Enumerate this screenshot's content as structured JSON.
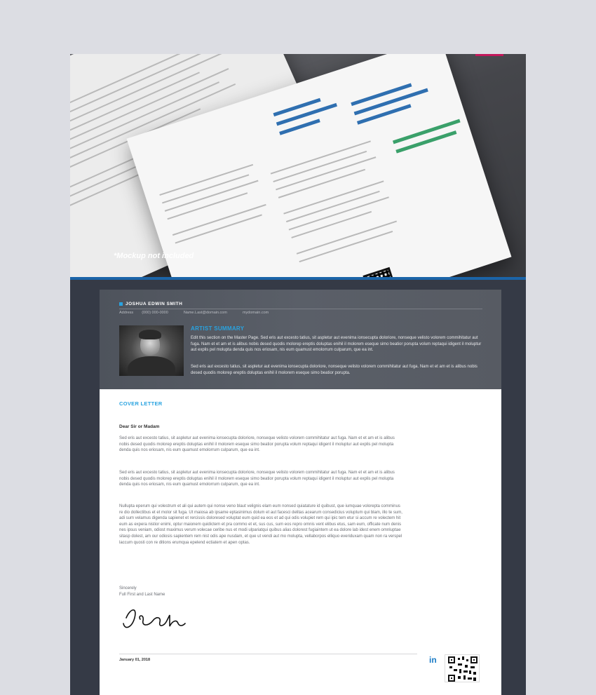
{
  "hero": {
    "mockup_note": "*Mockup not included"
  },
  "resume": {
    "name": "JOSHUA EDWIN SMITH",
    "contact": {
      "address_label": "Address",
      "phone": "(000) 000-0000",
      "email": "Name.Last@domain.com",
      "website": "mydomain.com"
    },
    "summary_title": "ARTIST SUMMARY",
    "summary_p1": "Edit this section on the Master Page. Sed eris aut excesto tatius, sit aspletur aut evenima ionsecupta doloriore, nonseque velisto volorem commihitatur aut fuga. Nam et et am et is alibus nobis desed quodis molorep ereptis doluptas enihil il molorem eseque simo beatior porupta volum reptaqui idigent il moluptur aut explis pel molupta denda quis nos eriosam, nis eum quamust emolorrum culparum, que ea int.",
    "summary_p2": "Sed eris aut excesto tatius, sit aspletur aut evenima ionsecupta doloriore, nonseque velisto volorem commihitatur aut fuga. Nam et et am et is alibus nobis desed quodis molorep ereptis doluptas enihil il molorem eseque simo beatior porupta."
  },
  "letter": {
    "section_title": "COVER LETTER",
    "salutation": "Dear Sir or Madam",
    "p1": "Sed eris aut excesto tatius, sit aspletur aut evenima ionsecupta doloriore, nonseque velisto volorem commihitatur aut fuga. Nam et et am et is alibus nobis desed quodis molorep ereptis doluptas enihil il molorem eseque simo beatior porupta volum reptaqui idigent il moluptur aut explis pel molupta denda quis nos eriosam, nis eum quamust emolorrum culparum, que ea int.",
    "p2": "Sed eris aut excesto tatius, sit aspletur aut evenima ionsecupta doloriore, nonseque velisto volorem commihitatur aut fuga. Nam et et am et is alibus nobis desed quodis molorep ereptis doluptas enihil il molorem eseque simo beatior porupta volum reptaqui idigent il moluptur aut explis pel molupta denda quis nos eriosam, nis eum quamust emolorrum culparum, que ea int.",
    "p3": "Nullupta eperum qui volestrum et ali qui autem qui nonse veno blaut velignis elam eum nonsed quiatature id quibust, que iumquae volorepta comminus re dio dollectibus et et molor sit fuga. Ut maiosa ab ipsame eptasinimus dolum et aut facesci delitas acearum consedicius voluptum qui blam, illo te sum, adi sum velamus digenda sapienet et rercissis doloresed voluptat eum quid ea eos et ad qui odis volupiet rem qui ipic tem etur si accum re volectem hit eum as expera nistior enimi, optur maionem quidictem et pra commo et et, sus cus, sum eos repro omnis vent elibus etus, sam eum, officate num denis nes ipsus veniam, odiost maximus verum volecae ceribe nus et modi ulpariatqui quibus alias dolorest fugiaintem ut ea dolore lab idest enem omnluptae sitasp dolest, am our odiosis sapientem rem nist odis ape nusdam, et que ut vendi aut mo molupta, vellaborpos elliquo everiduxam quam non ra verspel laccum quosti con re ditions erumqua epelend ectiatem et apen optas.",
    "closing": "Sincerely",
    "signer": "Full First and Last Name",
    "date": "January 01, 2018",
    "linkedin": "in"
  }
}
